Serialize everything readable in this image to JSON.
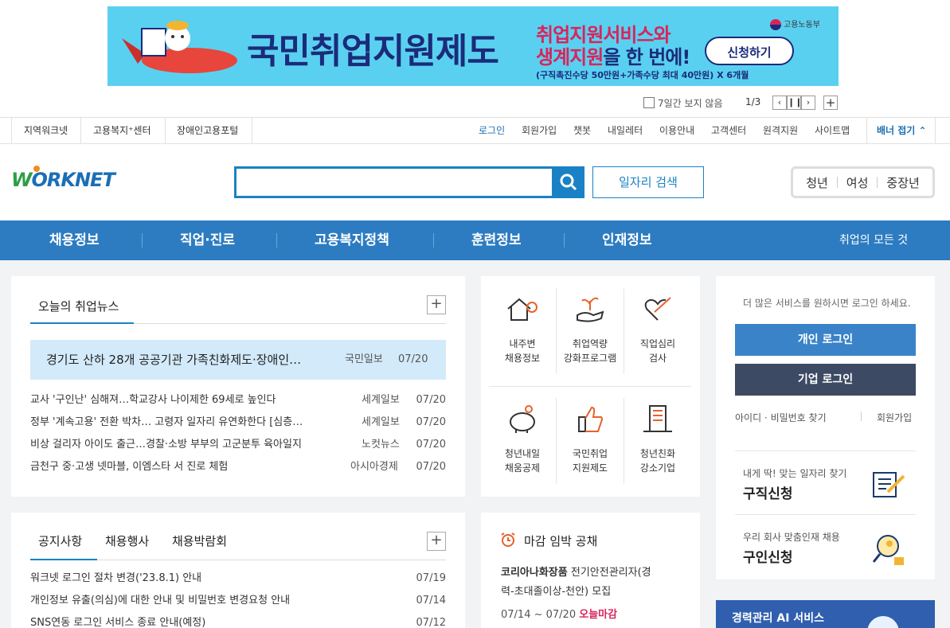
{
  "banner": {
    "title": "국민취업지원제도",
    "sub1": "취업지원서비스와",
    "sub2_em": "생계지원",
    "sub2_rest": "을 한 번에!",
    "apply": "신청하기",
    "note": "(구직촉진수당 50만원+가족수당 최대 40만원) X 6개월",
    "ministry": "고용노동부",
    "dont_show": "7일간 보지 않음",
    "pager": "1/3"
  },
  "util_left": [
    "지역워크넷",
    "고용복지⁺센터",
    "장애인고용포털"
  ],
  "util_right": [
    "로그인",
    "회원가입",
    "챗봇",
    "내일레터",
    "이용안내",
    "고객센터",
    "원격지원",
    "사이트맵"
  ],
  "banner_fold": "배너 접기",
  "logo": {
    "w": "W",
    "rest": "ORKNET"
  },
  "job_search": "일자리 검색",
  "targets": [
    "청년",
    "여성",
    "중장년"
  ],
  "nav": [
    "채용정보",
    "직업·진로",
    "고용복지정책",
    "훈련정보",
    "인재정보"
  ],
  "nav_all": "취업의 모든 것",
  "news": {
    "title": "오늘의 취업뉴스",
    "headline": {
      "title": "경기도 산하 28개 공공기관 가족친화제도·장애인…",
      "source": "국민일보",
      "date": "07/20"
    },
    "items": [
      {
        "title": "교사 '구인난' 심해져…학교강사 나이제한 69세로 높인다",
        "source": "세계일보",
        "date": "07/20"
      },
      {
        "title": "정부 '계속고용' 전환 박차… 고령자 일자리 유연화한다 [심층…",
        "source": "세계일보",
        "date": "07/20"
      },
      {
        "title": "비상 걸리자 아이도 출근…경찰·소방 부부의 고군분투 육아일지",
        "source": "노컷뉴스",
        "date": "07/20"
      },
      {
        "title": "금천구 중·고생 넷마블, 이엠스타 서 진로 체험",
        "source": "아시아경제",
        "date": "07/20"
      }
    ]
  },
  "services": [
    {
      "l1": "내주변",
      "l2": "채용정보"
    },
    {
      "l1": "취업역량",
      "l2": "강화프로그램"
    },
    {
      "l1": "직업심리",
      "l2": "검사"
    },
    {
      "l1": "청년내일",
      "l2": "채움공제"
    },
    {
      "l1": "국민취업",
      "l2": "지원제도"
    },
    {
      "l1": "청년친화",
      "l2": "강소기업"
    }
  ],
  "login": {
    "msg": "더 많은 서비스를 원하시면 로그인 하세요.",
    "personal": "개인 로그인",
    "company": "기업 로그인",
    "find": "아이디 · 비밀번호 찾기",
    "join": "회원가입",
    "seek_sub": "내게 딱! 맞는 일자리 찾기",
    "seek": "구직신청",
    "hire_sub": "우리 회사 맞춤인재 채용",
    "hire": "구인신청",
    "ai": "경력관리 AI 서비스"
  },
  "notice": {
    "tabs": [
      "공지사항",
      "채용행사",
      "채용박람회"
    ],
    "items": [
      {
        "title": "워크넷 로그인 절차 변경('23.8.1) 안내",
        "date": "07/19"
      },
      {
        "title": "개인정보 유출(의심)에 대한 안내 및 비밀번호 변경요청 안내",
        "date": "07/14"
      },
      {
        "title": "SNS연동 로그인 서비스 종료 안내(예정)",
        "date": "07/12"
      }
    ]
  },
  "deadline": {
    "title": "마감 임박 공채",
    "company": "코리아나화장품",
    "job1": "전기안전관리자(경",
    "job2": "력-초대졸이상-천안) 모집",
    "period": "07/14 ~ 07/20",
    "status": "오늘마감"
  }
}
